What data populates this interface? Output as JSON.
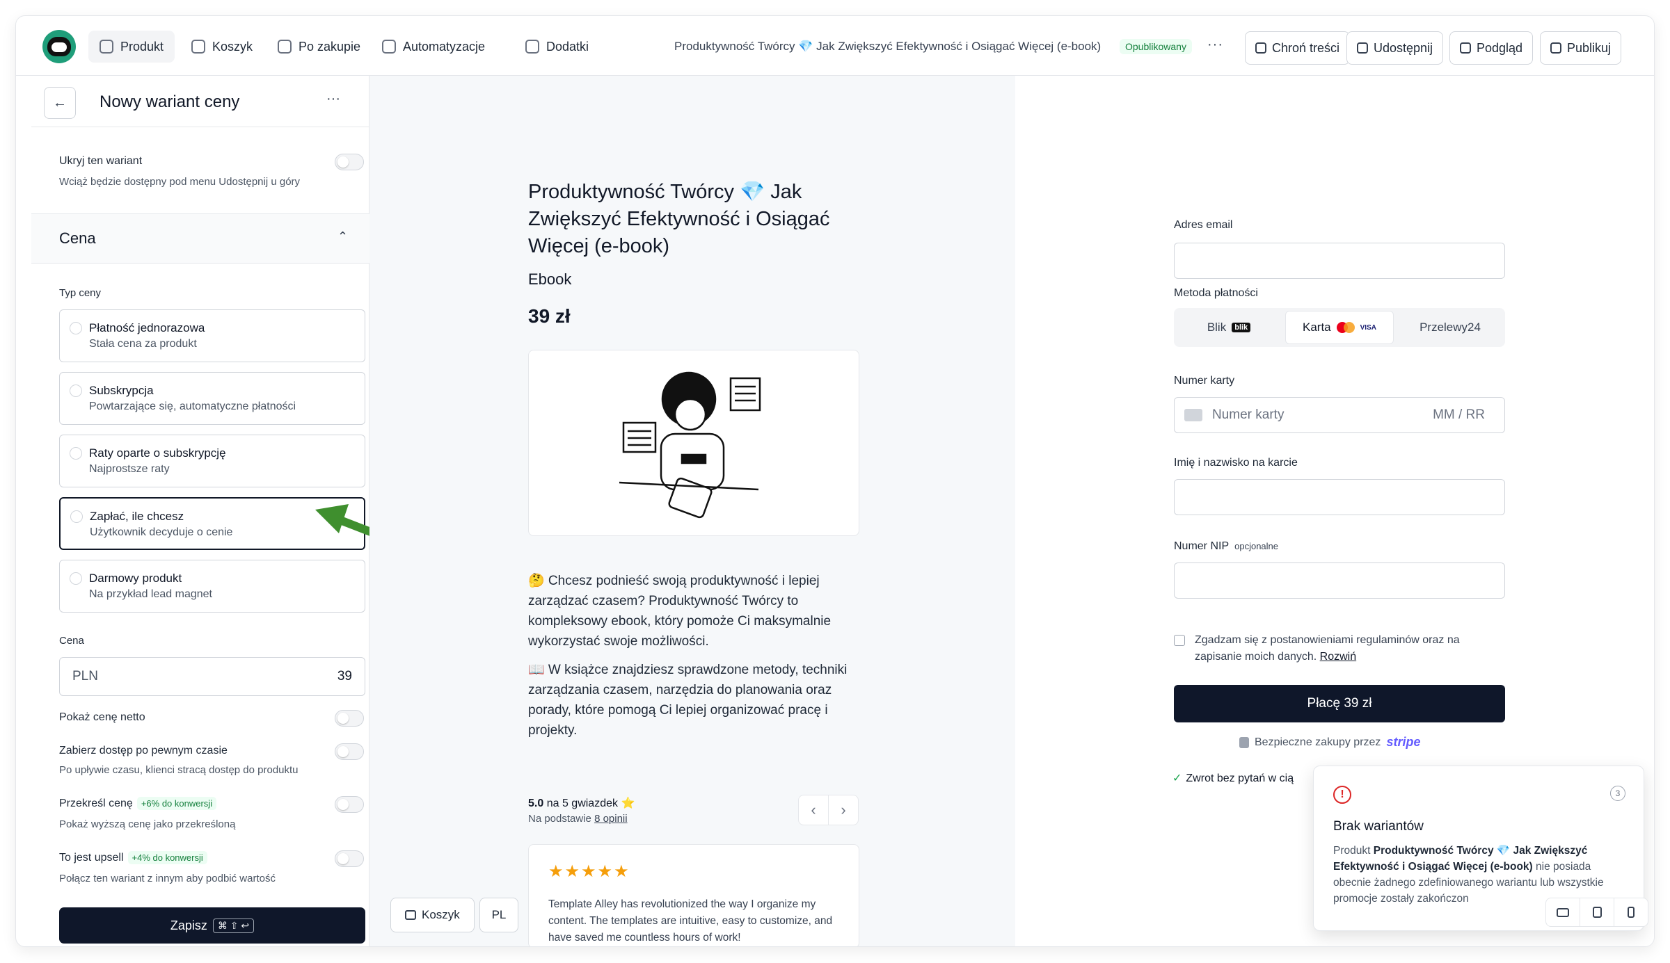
{
  "topbar": {
    "tabs": [
      {
        "label": "Produkt",
        "icon": "box-icon"
      },
      {
        "label": "Koszyk",
        "icon": "cart-icon"
      },
      {
        "label": "Po zakupie",
        "icon": "bag-icon"
      },
      {
        "label": "Automatyzacje",
        "icon": "flow-icon"
      },
      {
        "label": "Dodatki",
        "icon": "plus-icon"
      }
    ],
    "product_title": "Produktywność Twórcy 💎 Jak Zwiększyć Efektywność i Osiągać Więcej (e-book)",
    "status_badge": "Opublikowany",
    "more": "···",
    "buttons": {
      "protect": "Chroń treści",
      "share": "Udostępnij",
      "preview": "Podgląd",
      "publish": "Publikuj"
    }
  },
  "left_panel": {
    "title": "Nowy wariant ceny",
    "more": "···",
    "back": "←",
    "hide_label": "Ukryj ten wariant",
    "hide_sub": "Wciąż będzie dostępny pod menu Udostępnij u góry",
    "section_title": "Cena",
    "section_chevron": "⌃",
    "price_type_label": "Typ ceny",
    "price_types": [
      {
        "title": "Płatność jednorazowa",
        "sub": "Stała cena za produkt"
      },
      {
        "title": "Subskrypcja",
        "sub": "Powtarzające się, automatyczne płatności"
      },
      {
        "title": "Raty oparte o subskrypcję",
        "sub": "Najprostsze raty"
      },
      {
        "title": "Zapłać, ile chcesz",
        "sub": "Użytkownik decyduje o cenie"
      },
      {
        "title": "Darmowy produkt",
        "sub": "Na przykład lead magnet"
      }
    ],
    "price_label": "Cena",
    "price_currency": "PLN",
    "price_value": "39",
    "net_label": "Pokaż cenę netto",
    "revoke_label": "Zabierz dostęp po pewnym czasie",
    "revoke_sub": "Po upływie czasu, klienci stracą dostęp do produktu",
    "strike_label": "Przekreśl cenę",
    "strike_badge": "+6% do konwersji",
    "strike_sub": "Pokaż wyższą cenę jako przekreśloną",
    "upsell_label": "To jest upsell",
    "upsell_badge": "+4% do konwersji",
    "upsell_sub": "Połącz ten wariant z innym aby podbić wartość",
    "save_label": "Zapisz",
    "save_shortcut": "⌘ ⇧ ↩"
  },
  "preview": {
    "title": "Produktywność Twórcy 💎 Jak Zwiększyć Efektywność i Osiągać Więcej (e-book)",
    "type": "Ebook",
    "price": "39 zł",
    "desc1": "🤔 Chcesz podnieść swoją produktywność i lepiej zarządzać czasem? Produktywność Twórcy to kompleksowy ebook, który pomoże Ci maksymalnie wykorzystać swoje możliwości.",
    "desc2": "📖 W książce znajdziesz sprawdzone metody, techniki zarządzania czasem, narzędzia do planowania oraz porady, które pomogą Ci lepiej organizować pracę i projekty.",
    "rating_score": "5.0",
    "rating_text": "na 5 gwiazdek ⭐",
    "rating_prefix": "Na podstawie",
    "rating_link": "8 opinii",
    "stars": "★★★★★",
    "review": "Template Alley has revolutionized the way I organize my content. The templates are intuitive, easy to customize, and have saved me countless hours of work!",
    "prev": "‹",
    "next": "›",
    "cart_label": "Koszyk",
    "lang_label": "PL"
  },
  "checkout": {
    "email_label": "Adres email",
    "method_label": "Metoda płatności",
    "methods": {
      "blik": "Blik",
      "blik_logo": "blik",
      "card": "Karta",
      "visa": "VISA",
      "p24": "Przelewy24"
    },
    "card_label": "Numer karty",
    "card_placeholder": "Numer karty",
    "card_expiry": "MM / RR",
    "name_label": "Imię i nazwisko na karcie",
    "nip_label": "Numer NIP",
    "nip_optional": "opcjonalne",
    "consent": "Zgadzam się z postanowieniami regulaminów oraz na zapisanie moich danych.",
    "consent_link": "Rozwiń",
    "pay_button": "Płacę 39 zł",
    "secure_text": "Bezpieczne zakupy przez",
    "secure_brand": "stripe",
    "refund": "Zwrot bez pytań w cią"
  },
  "toast": {
    "count": "3",
    "title": "Brak wariantów",
    "body_prefix": "Produkt",
    "body_product": "Produktywność Twórcy 💎 Jak Zwiększyć Efektywność i Osiągać Więcej (e-book)",
    "body_suffix": "nie posiada obecnie żadnego zdefiniowanego wariantu lub wszystkie promocje zostały zakończon"
  },
  "colors": {
    "brand": "#1f9e7a",
    "primary": "#0f172a",
    "success": "#15803d",
    "arrow": "#3f8f2e",
    "error": "#dc2626"
  }
}
